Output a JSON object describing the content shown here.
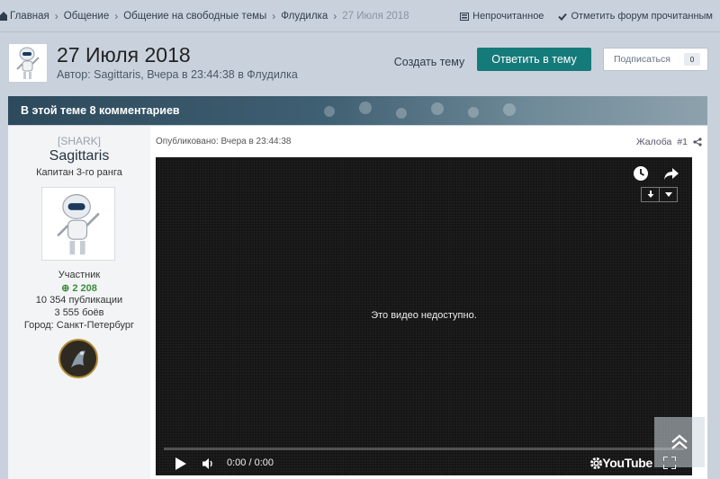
{
  "breadcrumb": {
    "items": [
      "Главная",
      "Общение",
      "Общение на свободные темы",
      "Флудилка"
    ],
    "current": "27 Июля 2018"
  },
  "header_actions": {
    "unread": "Непрочитанное",
    "mark_read": "Отметить форум прочитанным"
  },
  "topic": {
    "title": "27 Июля 2018",
    "meta": "Автор: Sagittaris, Вчера в 23:44:38 в Флудилка",
    "create_label": "Создать тему",
    "reply_label": "Ответить в тему",
    "follow_label": "Подписаться",
    "follow_count": "0"
  },
  "comments_bar": {
    "text": "В этой теме 8 комментариев"
  },
  "author": {
    "team": "[SHARK]",
    "name": "Sagittaris",
    "rank": "Капитан 3-го ранга",
    "group": "Участник",
    "reputation": "2 208",
    "posts": "10 354 публикации",
    "battles": "3 555 боёв",
    "city": "Город: Санкт-Петербург"
  },
  "post": {
    "published": "Опубликовано: Вчера в 23:44:38",
    "report": "Жалоба",
    "number": "#1"
  },
  "video": {
    "message": "Это видео недоступно.",
    "time": "0:00 / 0:00",
    "brand": "YouTube"
  },
  "colors": {
    "accent": "#157a7a",
    "page_bg": "#c9d2dc",
    "bar_dark": "#2d4a5c"
  }
}
